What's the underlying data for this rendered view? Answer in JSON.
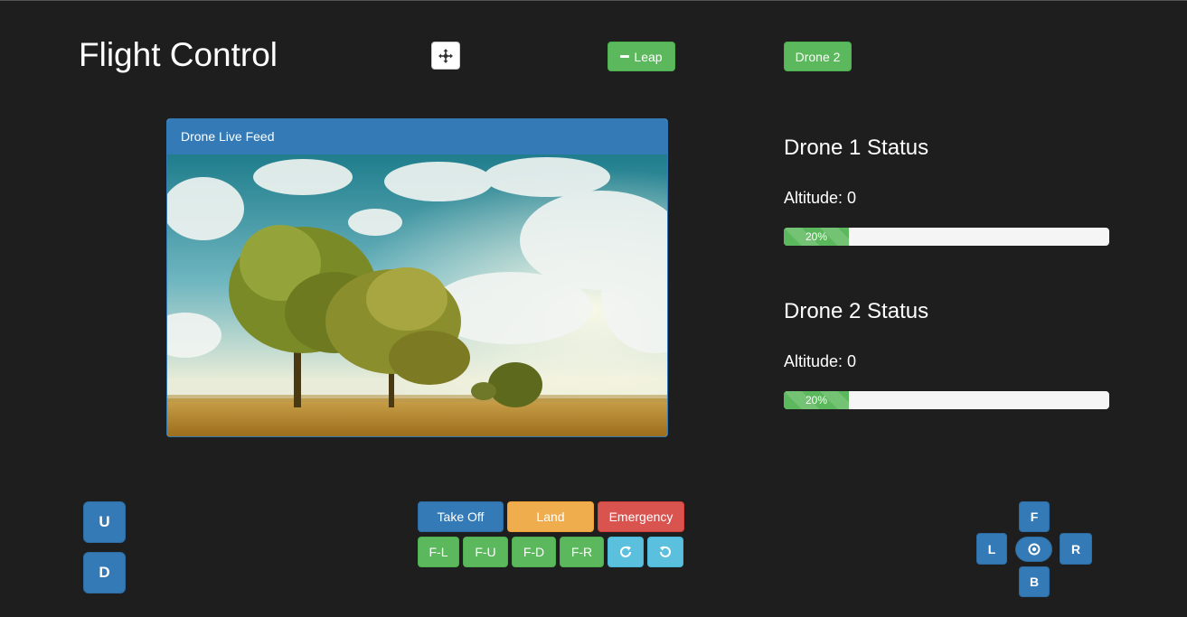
{
  "header": {
    "title": "Flight Control",
    "move_icon": "move-arrows-icon",
    "leap_label": "Leap",
    "leap_icon": "minus-icon",
    "drone_switch_label": "Drone 2"
  },
  "feed_panel": {
    "heading": "Drone Live Feed",
    "image": "landscape with trees under cloudy sky"
  },
  "status": [
    {
      "heading": "Drone 1 Status",
      "altitude_label": "Altitude: 0",
      "progress_label": "20%",
      "progress_value": 0.2
    },
    {
      "heading": "Drone 2 Status",
      "altitude_label": "Altitude: 0",
      "progress_label": "20%",
      "progress_value": 0.2
    }
  ],
  "vertical": {
    "up": "U",
    "down": "D"
  },
  "actions": {
    "takeoff": "Take Off",
    "land": "Land",
    "emergency": "Emergency"
  },
  "flips": {
    "fl": "F-L",
    "fu": "F-U",
    "fd": "F-D",
    "fr": "F-R",
    "rotate_cw_icon": "rotate-cw-icon",
    "rotate_ccw_icon": "rotate-ccw-icon"
  },
  "dpad": {
    "forward": "F",
    "left": "L",
    "right": "R",
    "back": "B",
    "center_icon": "record-icon"
  },
  "colors": {
    "primary": "#337ab7",
    "success": "#5cb85c",
    "warning": "#f0ad4e",
    "danger": "#d9534f",
    "info": "#5bc0de",
    "background": "#1e1e1e"
  }
}
